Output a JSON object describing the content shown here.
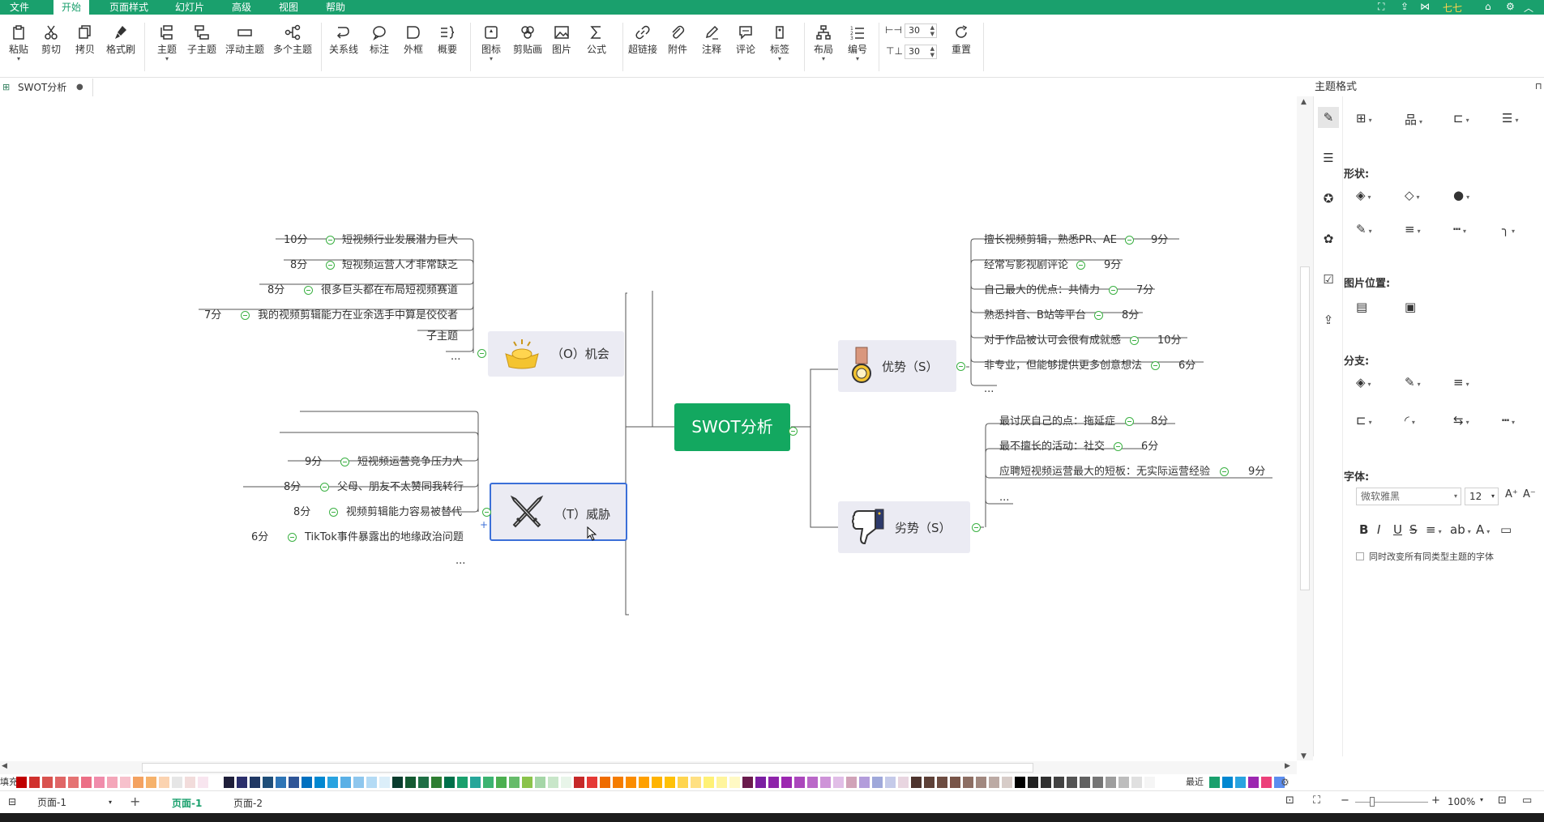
{
  "menu": {
    "items": [
      "文件",
      "开始",
      "页面样式",
      "幻灯片",
      "高级",
      "视图",
      "帮助"
    ],
    "active": "开始",
    "user": "七七"
  },
  "toolbar": {
    "paste": "粘贴",
    "cut": "剪切",
    "copy": "拷贝",
    "format_painter": "格式刷",
    "topic": "主题",
    "subtopic": "子主题",
    "floating_topic": "浮动主题",
    "multiple_topics": "多个主题",
    "relationship": "关系线",
    "callout": "标注",
    "boundary": "外框",
    "summary": "概要",
    "icon": "图标",
    "clipart": "剪贴画",
    "image": "图片",
    "formula": "公式",
    "hyperlink": "超链接",
    "attachment": "附件",
    "note": "注释",
    "comment": "评论",
    "tag": "标签",
    "layout": "布局",
    "numbering": "编号",
    "reset": "重置",
    "spacing_h": "30",
    "spacing_v": "30"
  },
  "doc_tab": {
    "title": "SWOT分析"
  },
  "panel": {
    "title": "主题格式",
    "shape_label": "形状:",
    "image_position_label": "图片位置:",
    "branch_label": "分支:",
    "font_label": "字体:",
    "font_family": "微软雅黑",
    "font_size": "12",
    "same_type_checkbox": "同时改变所有同类型主题的字体"
  },
  "mindmap": {
    "central": "SWOT分析",
    "opportunity": {
      "label": "（O）机会",
      "items": [
        {
          "score": "10分",
          "text": "短视频行业发展潜力巨大"
        },
        {
          "score": "8分",
          "text": "短视频运营人才非常缺乏"
        },
        {
          "score": "8分",
          "text": "很多巨头都在布局短视频赛道"
        },
        {
          "score": "7分",
          "text": "我的视频剪辑能力在业余选手中算是佼佼者"
        },
        {
          "score": "",
          "text": "子主题"
        },
        {
          "score": "",
          "text": "..."
        }
      ]
    },
    "threat": {
      "label": "（T）威胁",
      "items": [
        {
          "score": "9分",
          "text": "短视频运营竞争压力大"
        },
        {
          "score": "8分",
          "text": "父母、朋友不太赞同我转行"
        },
        {
          "score": "8分",
          "text": "视频剪辑能力容易被替代"
        },
        {
          "score": "6分",
          "text": "TikTok事件暴露出的地缘政治问题"
        },
        {
          "score": "",
          "text": "..."
        }
      ]
    },
    "strength": {
      "label": "优势（S）",
      "items": [
        {
          "score": "9分",
          "text": "擅长视频剪辑，熟悉PR、AE"
        },
        {
          "score": "9分",
          "text": "经常写影视剧评论"
        },
        {
          "score": "7分",
          "text": "自己最大的优点：共情力"
        },
        {
          "score": "8分",
          "text": "熟悉抖音、B站等平台"
        },
        {
          "score": "10分",
          "text": "对于作品被认可会很有成就感"
        },
        {
          "score": "6分",
          "text": "非专业，但能够提供更多创意想法"
        },
        {
          "score": "",
          "text": "..."
        }
      ]
    },
    "weakness": {
      "label": "劣势（S）",
      "items": [
        {
          "score": "8分",
          "text": "最讨厌自己的点：拖延症"
        },
        {
          "score": "6分",
          "text": "最不擅长的活动：社交"
        },
        {
          "score": "9分",
          "text": "应聘短视频运营最大的短板：无实际运营经验"
        },
        {
          "score": "",
          "text": "..."
        }
      ]
    }
  },
  "palette": {
    "fill_label": "填充",
    "recent_label": "最近",
    "colors": [
      "#c00000",
      "#d0312d",
      "#d9534f",
      "#e06666",
      "#e57373",
      "#ec6f86",
      "#f08cab",
      "#f4a6b9",
      "#f7c1cc",
      "#f4a261",
      "#f6b26b",
      "#fbd3b0",
      "#e6e6e6",
      "#f2dcdb",
      "#f8e5ef",
      "#ffffff",
      "#1f1f3a",
      "#2b2f6b",
      "#203864",
      "#1f4e79",
      "#2e75b6",
      "#2f5597",
      "#0070c0",
      "#0288d1",
      "#29a3e0",
      "#5ab0e6",
      "#8ec7ee",
      "#b4dbf5",
      "#dbeef9",
      "#0b3d2e",
      "#145a32",
      "#1e6f45",
      "#2e7d32",
      "#00704a",
      "#1aa06d",
      "#26a69a",
      "#3cb371",
      "#4caf50",
      "#66bb6a",
      "#8bc34a",
      "#a5d6a7",
      "#c8e6c9",
      "#e8f5e9",
      "#c62828",
      "#e53935",
      "#ef6c00",
      "#f57c00",
      "#fb8c00",
      "#ffa000",
      "#ffb300",
      "#ffc107",
      "#ffd54f",
      "#ffe082",
      "#fff176",
      "#fff59d",
      "#fff9c4",
      "#6a1b4d",
      "#7b1fa2",
      "#8e24aa",
      "#9c27b0",
      "#ab47bc",
      "#ba68c8",
      "#ce93d8",
      "#e1bee7",
      "#d1a3b8",
      "#b39ddb",
      "#9fa8da",
      "#c5cae9",
      "#e8d5e0",
      "#4e342e",
      "#5d4037",
      "#6d4c41",
      "#795548",
      "#8d6e63",
      "#a1887f",
      "#bcaaa4",
      "#d7ccc8",
      "#000000",
      "#212121",
      "#303030",
      "#424242",
      "#545454",
      "#616161",
      "#757575",
      "#9e9e9e",
      "#bdbdbd",
      "#e0e0e0",
      "#f5f5f5"
    ],
    "recent_colors": [
      "#1aa06d",
      "#0288d1",
      "#29a3e0",
      "#9c27b0",
      "#ec407a",
      "#5b8def"
    ]
  },
  "statusbar": {
    "page_select": "页面-1",
    "tab1": "页面-1",
    "tab2": "页面-2",
    "zoom": "100%"
  }
}
